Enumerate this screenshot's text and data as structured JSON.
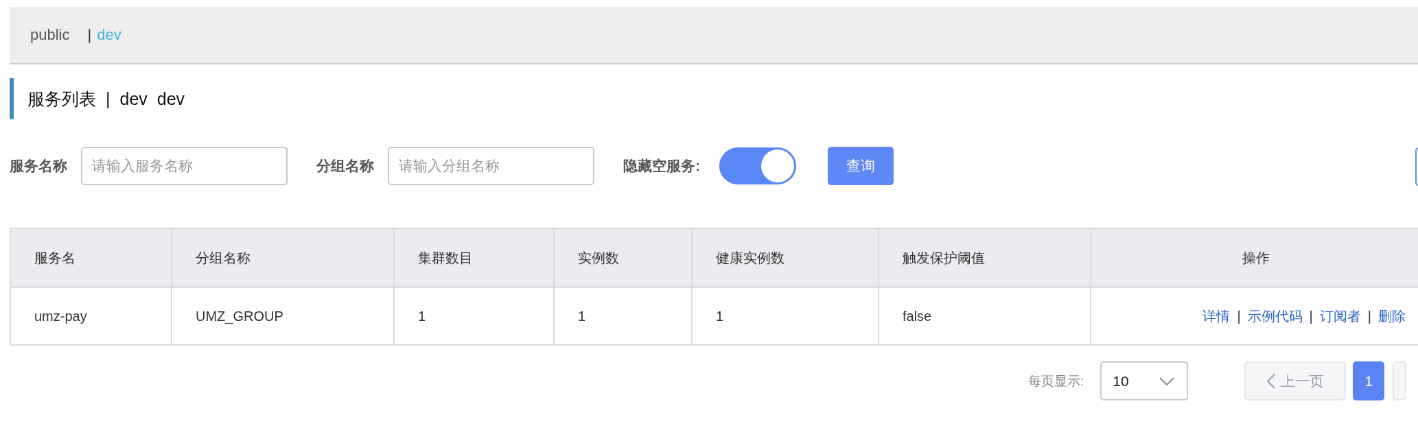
{
  "namespaces": [
    {
      "label": "public",
      "selected": false
    },
    {
      "label": "dev",
      "selected": true,
      "separator": "|"
    }
  ],
  "title": {
    "main": "服务列表",
    "separator": "|",
    "namespace": "dev",
    "namespace_id": "dev"
  },
  "filters": {
    "service_label": "服务名称",
    "service_placeholder": "请输入服务名称",
    "group_label": "分组名称",
    "group_placeholder": "请输入分组名称",
    "hide_label": "隐藏空服务:",
    "hide_empty": {
      "on": true
    },
    "query_button": "查询"
  },
  "table": {
    "columns": [
      "服务名",
      "分组名称",
      "集群数目",
      "实例数",
      "健康实例数",
      "触发保护阈值",
      "操作"
    ],
    "rows": [
      {
        "cells": [
          "umz-pay",
          "UMZ_GROUP",
          "1",
          "1",
          "1",
          "false"
        ],
        "actions": [
          {
            "label": "详情"
          },
          {
            "label": "示例代码",
            "separator": "|"
          },
          {
            "label": "订阅者",
            "separator": "|"
          },
          {
            "label": "删除",
            "separator": "|"
          }
        ]
      }
    ]
  },
  "pagination": {
    "page_size_label": "每页显示:",
    "page_size": "10",
    "prev": "上一页",
    "prev_disabled": true,
    "pages": [
      {
        "label": "1",
        "selected": true
      }
    ]
  }
}
